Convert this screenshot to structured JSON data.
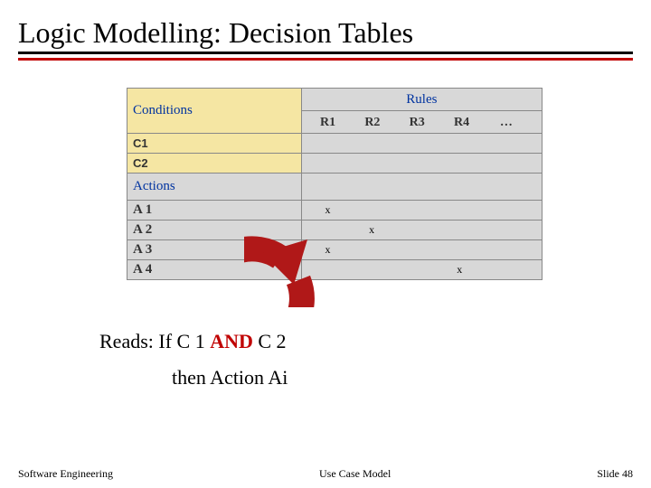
{
  "title": "Logic Modelling: Decision Tables",
  "table": {
    "conditions_header": "Conditions",
    "rules_header": "Rules",
    "rule_cols": [
      "R1",
      "R2",
      "R3",
      "R4",
      "…"
    ],
    "conditions": [
      "C1",
      "C2"
    ],
    "actions_header": "Actions",
    "actions": [
      "A 1",
      "A 2",
      "A 3",
      "A 4"
    ],
    "action_marks": [
      [
        "x",
        "",
        "",
        "",
        ""
      ],
      [
        "",
        "x",
        "",
        "",
        ""
      ],
      [
        "x",
        "",
        "",
        "",
        ""
      ],
      [
        "",
        "",
        "",
        "x",
        ""
      ]
    ]
  },
  "reads": {
    "prefix": "Reads: If C 1 ",
    "and": "AND",
    "after_and": " C 2",
    "line2": "then  Action Ai"
  },
  "footer": {
    "left": "Software Engineering",
    "center": "Use Case Model",
    "right": "Slide  48"
  }
}
